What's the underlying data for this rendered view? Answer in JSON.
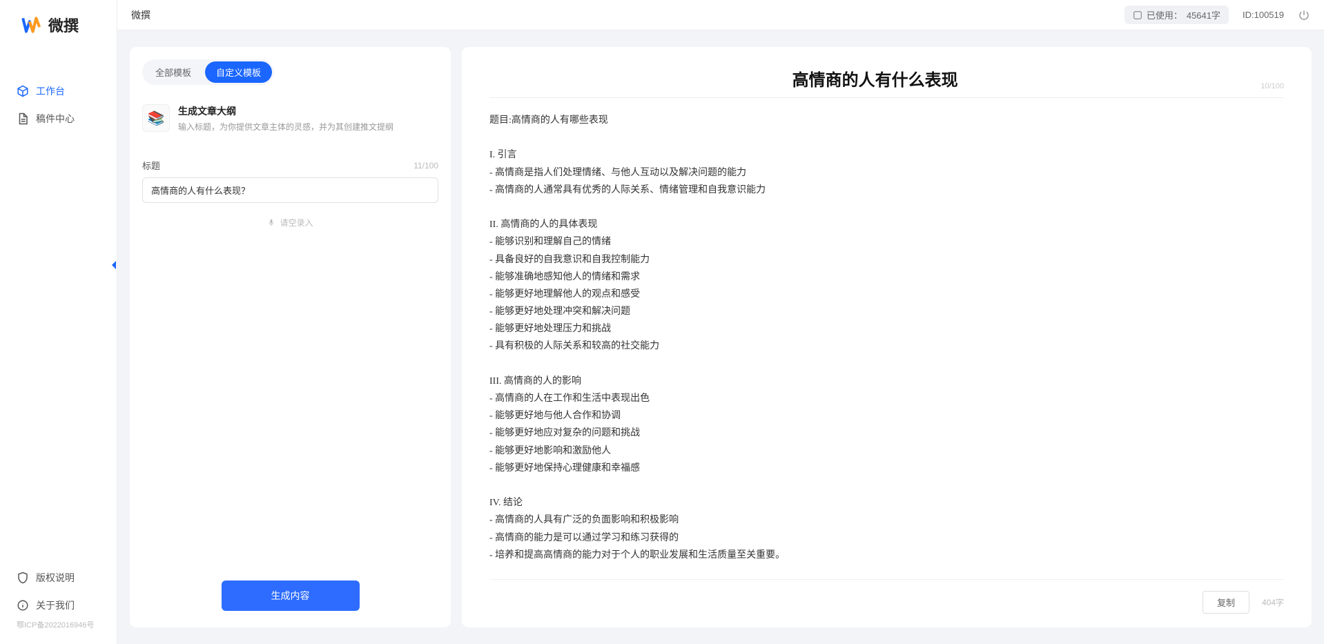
{
  "app": {
    "name": "微撰",
    "logo_text": "微撰"
  },
  "sidebar": {
    "nav": [
      {
        "label": "工作台",
        "active": true
      },
      {
        "label": "稿件中心",
        "active": false
      }
    ],
    "bottom": [
      {
        "label": "版权说明"
      },
      {
        "label": "关于我们"
      }
    ],
    "icp": "鄂ICP备2022016946号"
  },
  "topbar": {
    "title": "微撰",
    "usage_label": "已使用：",
    "usage_value": "45641字",
    "id_label": "ID:100519"
  },
  "left_panel": {
    "tabs": [
      {
        "label": "全部模板",
        "active": false
      },
      {
        "label": "自定义模板",
        "active": true
      }
    ],
    "template": {
      "icon": "📚",
      "title": "生成文章大纲",
      "desc": "输入标题，为你提供文章主体的灵感，并为其创建推文提纲"
    },
    "field": {
      "label": "标题",
      "counter": "11/100",
      "value": "高情商的人有什么表现？"
    },
    "voice_label": "请空录入",
    "generate_button": "生成内容"
  },
  "output": {
    "title": "高情商的人有什么表现",
    "title_counter": "10/100",
    "body": "题目:高情商的人有哪些表现\n\nI. 引言\n- 高情商是指人们处理情绪、与他人互动以及解决问题的能力\n- 高情商的人通常具有优秀的人际关系、情绪管理和自我意识能力\n\nII. 高情商的人的具体表现\n- 能够识别和理解自己的情绪\n- 具备良好的自我意识和自我控制能力\n- 能够准确地感知他人的情绪和需求\n- 能够更好地理解他人的观点和感受\n- 能够更好地处理冲突和解决问题\n- 能够更好地处理压力和挑战\n- 具有积极的人际关系和较高的社交能力\n\nIII. 高情商的人的影响\n- 高情商的人在工作和生活中表现出色\n- 能够更好地与他人合作和协调\n- 能够更好地应对复杂的问题和挑战\n- 能够更好地影响和激励他人\n- 能够更好地保持心理健康和幸福感\n\nIV. 结论\n- 高情商的人具有广泛的负面影响和积极影响\n- 高情商的能力是可以通过学习和练习获得的\n- 培养和提高高情商的能力对于个人的职业发展和生活质量至关重要。",
    "copy_label": "复制",
    "word_count": "404字"
  }
}
